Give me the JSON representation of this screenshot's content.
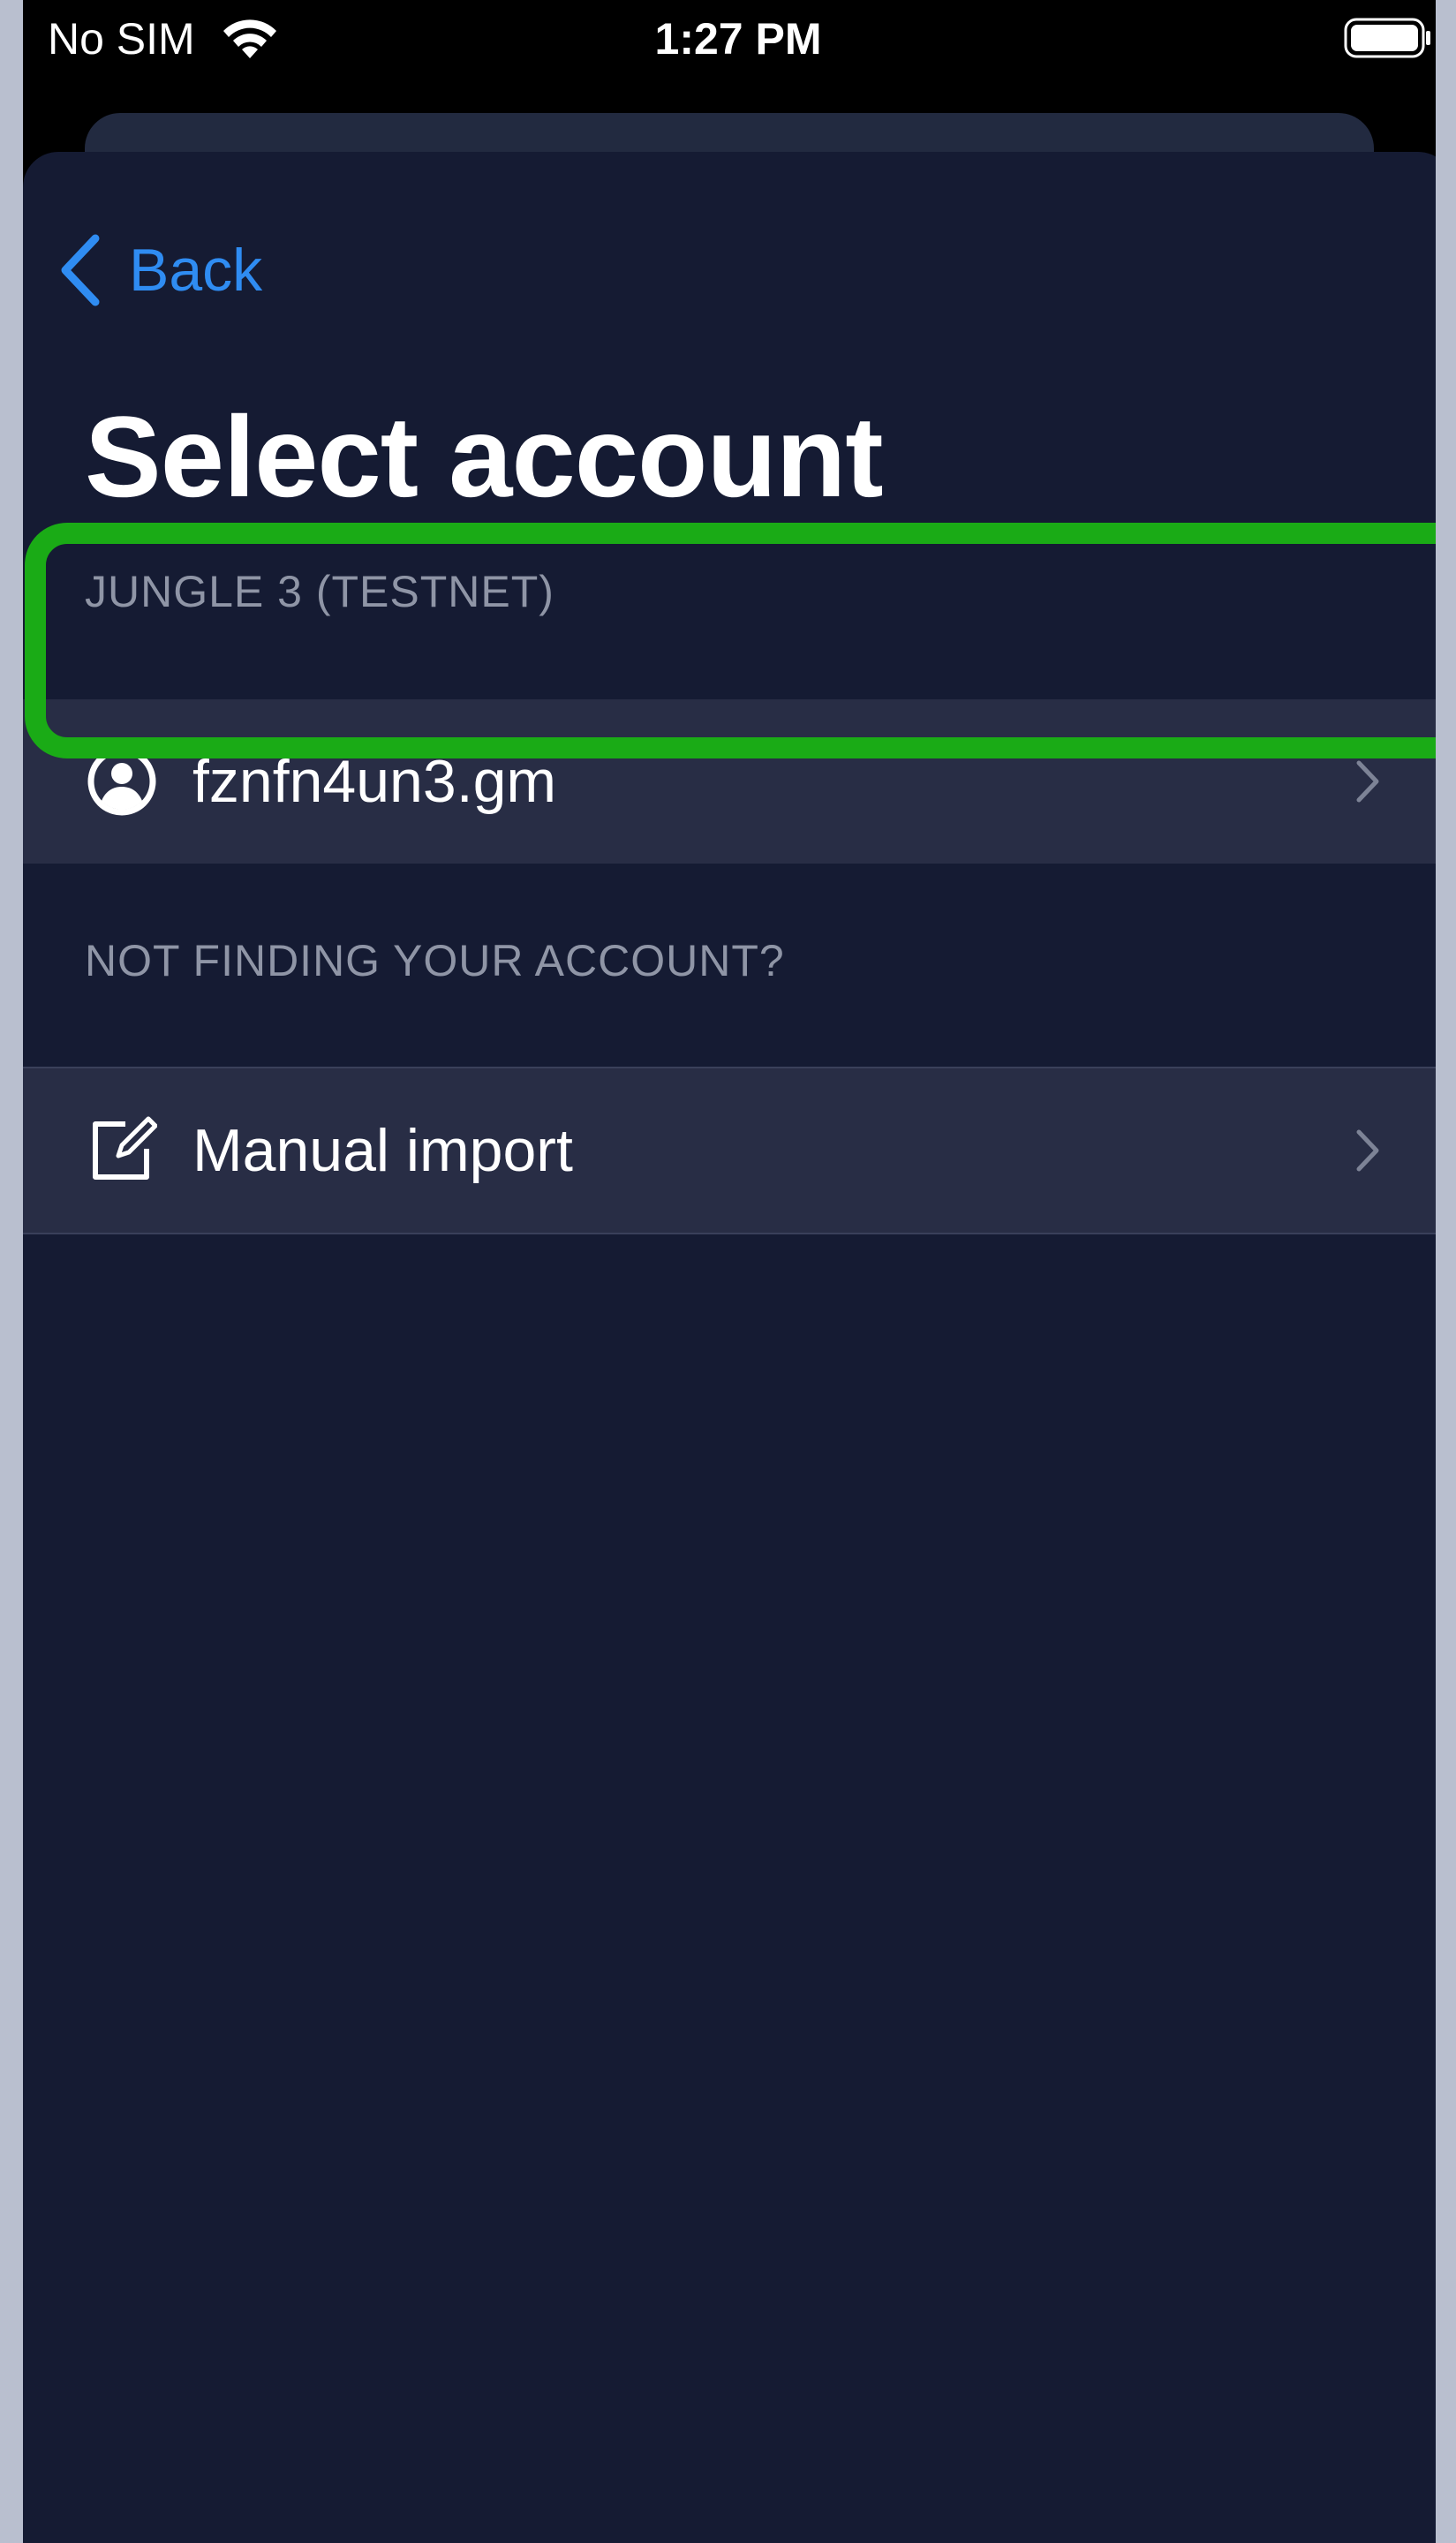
{
  "status_bar": {
    "carrier": "No SIM",
    "time": "1:27 PM",
    "wifi_icon": "wifi-icon",
    "battery_icon": "battery-full-icon"
  },
  "nav": {
    "back_label": "Back",
    "back_icon": "chevron-left-icon"
  },
  "page": {
    "title": "Select account"
  },
  "accounts_section": {
    "header": "JUNGLE 3 (TESTNET)",
    "items": [
      {
        "label": "fznfn4un3.gm",
        "icon": "user-circle-icon",
        "highlighted": true
      }
    ]
  },
  "import_section": {
    "header": "NOT FINDING YOUR ACCOUNT?",
    "items": [
      {
        "label": "Manual import",
        "icon": "edit-square-icon"
      }
    ]
  },
  "colors": {
    "background": "#151b33",
    "row_background": "#282d45",
    "accent": "#2f8cf2",
    "highlight": "#1aab16",
    "section_header": "#8f95a6"
  }
}
